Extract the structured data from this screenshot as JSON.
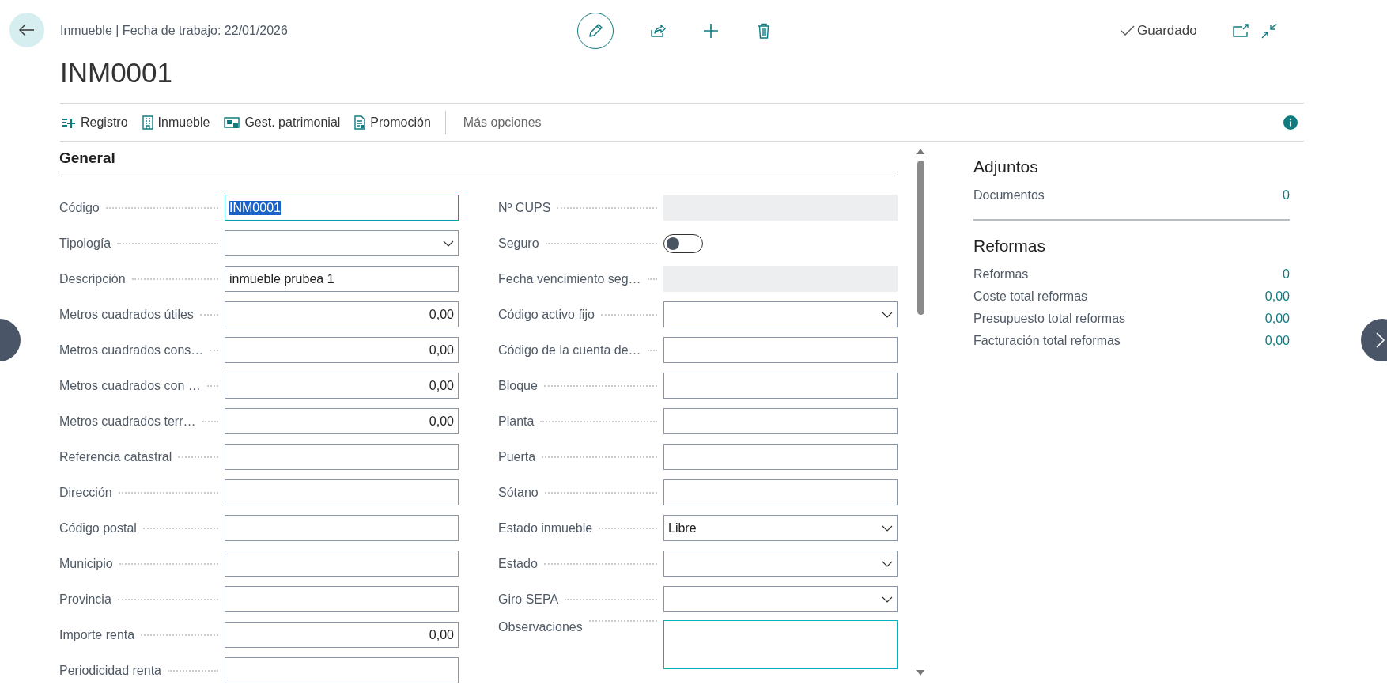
{
  "header": {
    "breadcrumb": "Inmueble | Fecha de trabajo: 22/01/2026",
    "title": "INM0001",
    "status": "Guardado"
  },
  "actions": [
    {
      "label": "Registro"
    },
    {
      "label": "Inmueble"
    },
    {
      "label": "Gest. patrimonial"
    },
    {
      "label": "Promoción"
    }
  ],
  "more_actions": "Más opciones",
  "section": {
    "title": "General"
  },
  "left_fields": [
    {
      "label": "Código",
      "kind": "text",
      "value": "INM0001",
      "focused": true
    },
    {
      "label": "Tipología",
      "kind": "dropdown",
      "focused": false
    },
    {
      "label": "Descripción",
      "kind": "text",
      "value": "inmueble prubea 1",
      "focused": false
    },
    {
      "label": "Metros cuadrados útiles",
      "kind": "number",
      "value": "0,00",
      "focused": false
    },
    {
      "label": "Metros cuadrados cons…",
      "kind": "number",
      "value": "0,00",
      "focused": false
    },
    {
      "label": "Metros cuadrados con …",
      "kind": "number",
      "value": "0,00",
      "focused": false
    },
    {
      "label": "Metros cuadrados terr…",
      "kind": "number",
      "value": "0,00",
      "focused": false
    },
    {
      "label": "Referencia catastral",
      "kind": "text",
      "focused": false
    },
    {
      "label": "Dirección",
      "kind": "text",
      "focused": false
    },
    {
      "label": "Código postal",
      "kind": "text",
      "focused": false
    },
    {
      "label": "Municipio",
      "kind": "text",
      "focused": false
    },
    {
      "label": "Provincia",
      "kind": "text",
      "focused": false
    },
    {
      "label": "Importe renta",
      "kind": "number",
      "value": "0,00",
      "focused": false
    },
    {
      "label": "Periodicidad renta",
      "kind": "text",
      "focused": false
    }
  ],
  "right_fields": [
    {
      "label": "Nº CUPS",
      "kind": "readonly"
    },
    {
      "label": "Seguro",
      "kind": "toggle",
      "on": false
    },
    {
      "label": "Fecha vencimiento seg…",
      "kind": "readonly"
    },
    {
      "label": "Código activo fijo",
      "kind": "dropdown"
    },
    {
      "label": "Código de la cuenta de…",
      "kind": "text"
    },
    {
      "label": "Bloque",
      "kind": "text"
    },
    {
      "label": "Planta",
      "kind": "text"
    },
    {
      "label": "Puerta",
      "kind": "text"
    },
    {
      "label": "Sótano",
      "kind": "text"
    },
    {
      "label": "Estado inmueble",
      "kind": "dropdown",
      "value": "Libre"
    },
    {
      "label": "Estado",
      "kind": "dropdown"
    },
    {
      "label": "Giro SEPA",
      "kind": "dropdown"
    },
    {
      "label": "Observaciones",
      "kind": "textarea"
    }
  ],
  "factbox": [
    {
      "title": "Adjuntos",
      "rows": [
        {
          "label": "Documentos",
          "value": "0"
        }
      ]
    },
    {
      "title": "Reformas",
      "rows": [
        {
          "label": "Reformas",
          "value": "0"
        },
        {
          "label": "Coste total reformas",
          "value": "0,00"
        },
        {
          "label": "Presupuesto total reformas",
          "value": "0,00"
        },
        {
          "label": "Facturación total reformas",
          "value": "0,00"
        }
      ]
    }
  ]
}
